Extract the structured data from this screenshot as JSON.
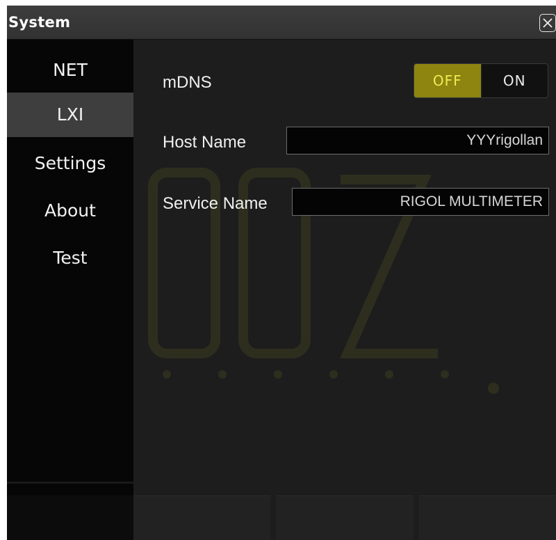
{
  "window": {
    "title": "System",
    "close_icon": "close-icon"
  },
  "sidebar": {
    "items": [
      {
        "label": "NET",
        "active": false
      },
      {
        "label": "LXI",
        "active": true
      },
      {
        "label": "Settings",
        "active": false
      },
      {
        "label": "About",
        "active": false
      },
      {
        "label": "Test",
        "active": false
      }
    ]
  },
  "lxi": {
    "mdns": {
      "label": "mDNS",
      "off_label": "OFF",
      "on_label": "ON",
      "selected": "OFF"
    },
    "host_name": {
      "label": "Host Name",
      "value": "YYYrigollan"
    },
    "service_name": {
      "label": "Service Name",
      "value": "RIGOL MULTIMETER"
    }
  },
  "colors": {
    "accent": "#8d8510",
    "accent_text": "#f2ea50",
    "panel_bg": "#1d1d1d",
    "sidebar_bg": "#060606",
    "sidebar_active": "#3e3e3e"
  }
}
